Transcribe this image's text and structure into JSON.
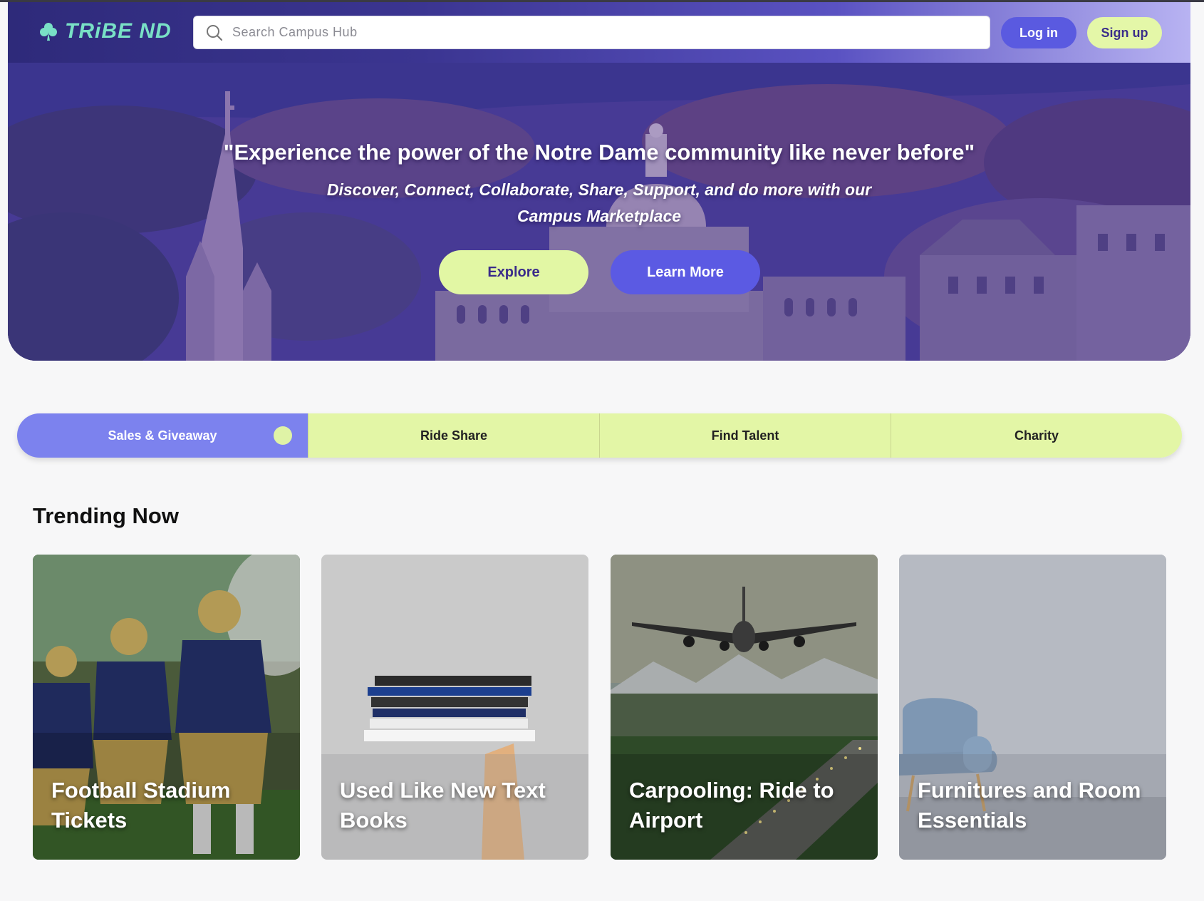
{
  "header": {
    "brand": "TRiBE ND",
    "search_placeholder": "Search Campus Hub",
    "login_label": "Log in",
    "signup_label": "Sign up"
  },
  "hero": {
    "title": "\"Experience the power of the Notre Dame community like never before\"",
    "subtitle": "Discover, Connect, Collaborate, Share, Support, and do more with our Campus Marketplace",
    "explore_label": "Explore",
    "learn_more_label": "Learn More"
  },
  "tabs": [
    {
      "label": "Sales & Giveaway",
      "active": true
    },
    {
      "label": "Ride Share",
      "active": false
    },
    {
      "label": "Find Talent",
      "active": false
    },
    {
      "label": "Charity",
      "active": false
    }
  ],
  "trending": {
    "heading": "Trending Now",
    "cards": [
      {
        "title": "Football Stadium Tickets"
      },
      {
        "title": "Used Like New Text Books"
      },
      {
        "title": "Carpooling: Ride to Airport"
      },
      {
        "title": "Furnitures and Room Essentials"
      }
    ]
  },
  "colors": {
    "accent_purple": "#5a5ae0",
    "accent_lime": "#e3f6a6",
    "brand_teal": "#79e0c6",
    "header_dark": "#2e2a7a"
  }
}
